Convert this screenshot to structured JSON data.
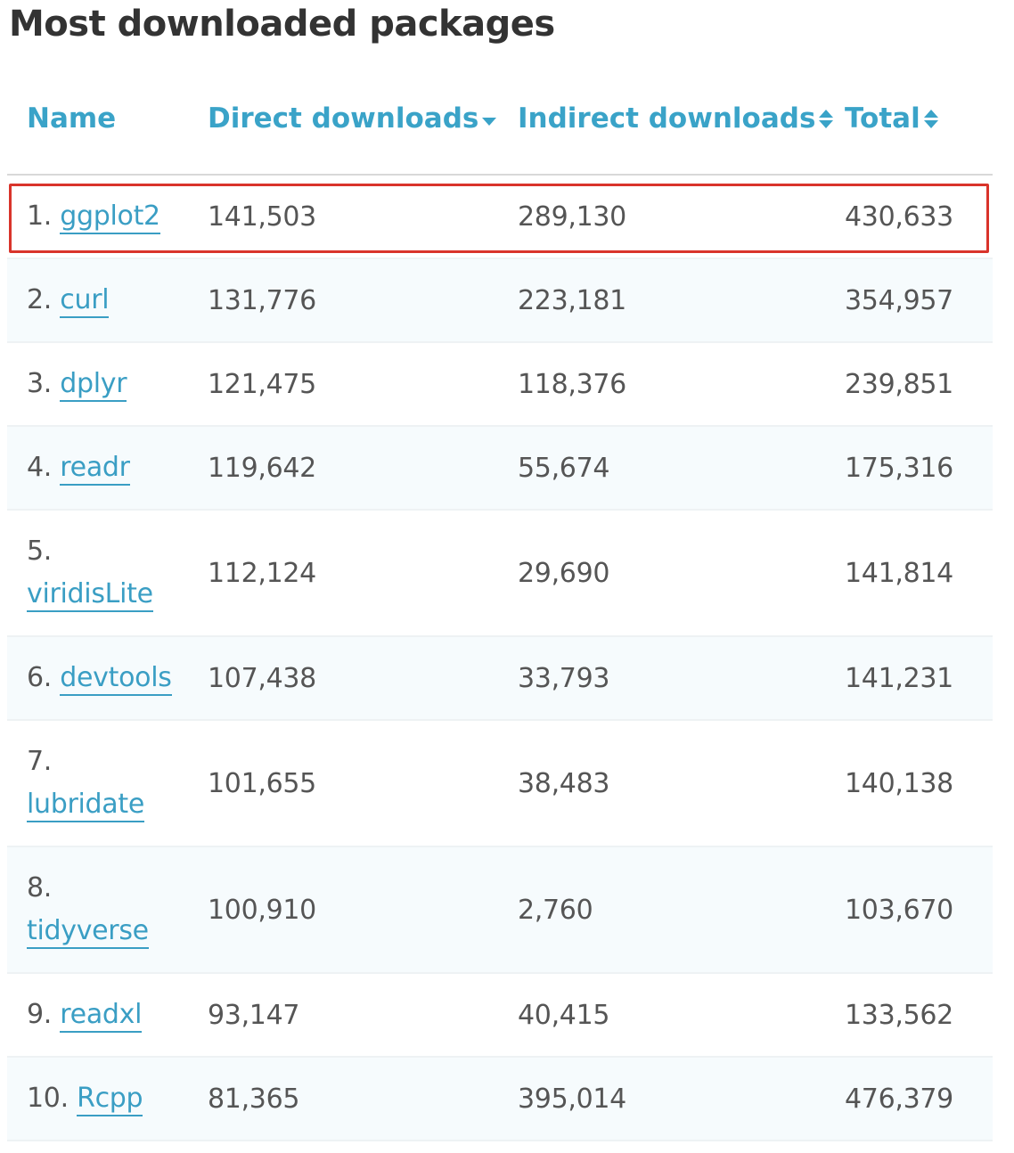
{
  "page": {
    "title": "Most downloaded packages"
  },
  "colors": {
    "header_text": "#3aa3c8",
    "link": "#3a9ec4",
    "body_text": "#555555",
    "title_text": "#333333",
    "highlight_border": "#d9342b",
    "alt_row": "#f6fbfd"
  },
  "table": {
    "columns": {
      "name": "Name",
      "direct": "Direct downloads",
      "indirect": "Indirect downloads",
      "total": "Total"
    },
    "sort": {
      "direct": "descending",
      "indirect": "unsorted",
      "total": "unsorted"
    },
    "rows": [
      {
        "rank": "1.",
        "name": "ggplot2",
        "direct": "141,503",
        "indirect": "289,130",
        "total": "430,633"
      },
      {
        "rank": "2.",
        "name": "curl",
        "direct": "131,776",
        "indirect": "223,181",
        "total": "354,957"
      },
      {
        "rank": "3.",
        "name": "dplyr",
        "direct": "121,475",
        "indirect": "118,376",
        "total": "239,851"
      },
      {
        "rank": "4.",
        "name": "readr",
        "direct": "119,642",
        "indirect": "55,674",
        "total": "175,316"
      },
      {
        "rank": "5.",
        "name": "viridisLite",
        "direct": "112,124",
        "indirect": "29,690",
        "total": "141,814"
      },
      {
        "rank": "6.",
        "name": "devtools",
        "direct": "107,438",
        "indirect": "33,793",
        "total": "141,231"
      },
      {
        "rank": "7.",
        "name": "lubridate",
        "direct": "101,655",
        "indirect": "38,483",
        "total": "140,138"
      },
      {
        "rank": "8.",
        "name": "tidyverse",
        "direct": "100,910",
        "indirect": "2,760",
        "total": "103,670"
      },
      {
        "rank": "9.",
        "name": "readxl",
        "direct": "93,147",
        "indirect": "40,415",
        "total": "133,562"
      },
      {
        "rank": "10.",
        "name": "Rcpp",
        "direct": "81,365",
        "indirect": "395,014",
        "total": "476,379"
      }
    ]
  }
}
